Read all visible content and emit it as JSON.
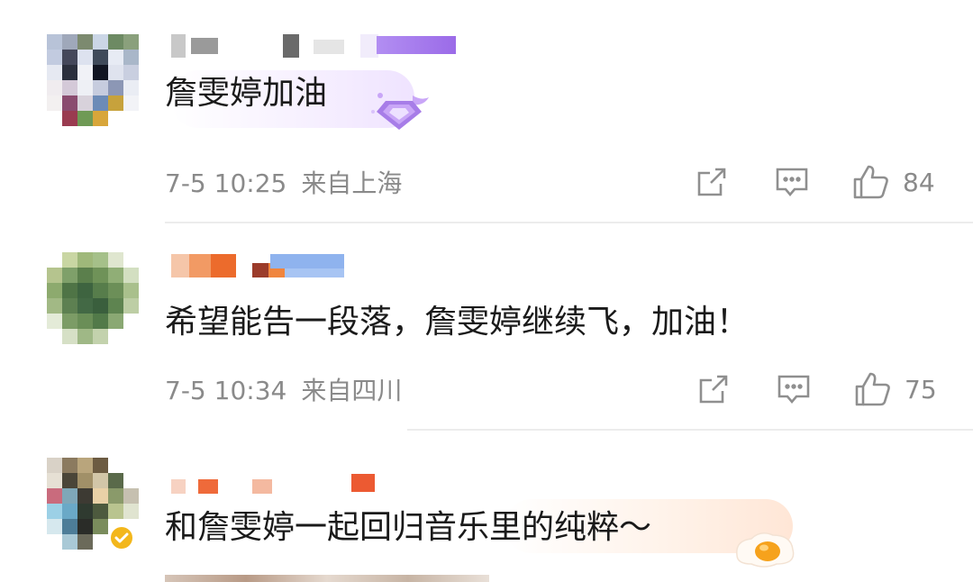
{
  "comments": [
    {
      "text": "詹雯婷加油",
      "time": "7-5 10:25",
      "location": "来自上海",
      "likes": "84",
      "bubble_color": "#f6efff",
      "badge": "diamond-badge-icon"
    },
    {
      "text": "希望能告一段落，詹雯婷继续飞，加油！",
      "time": "7-5 10:34",
      "location": "来自四川",
      "likes": "75"
    },
    {
      "text": "和詹雯婷一起回归音乐里的纯粹～",
      "bubble_color": "#fff3ea",
      "badge": "fried-egg-icon",
      "verified": "verified-badge-icon"
    }
  ],
  "colors": {
    "icon": "#8f8f8f",
    "meta_text": "#8a8a8a",
    "divider": "#ececec"
  }
}
